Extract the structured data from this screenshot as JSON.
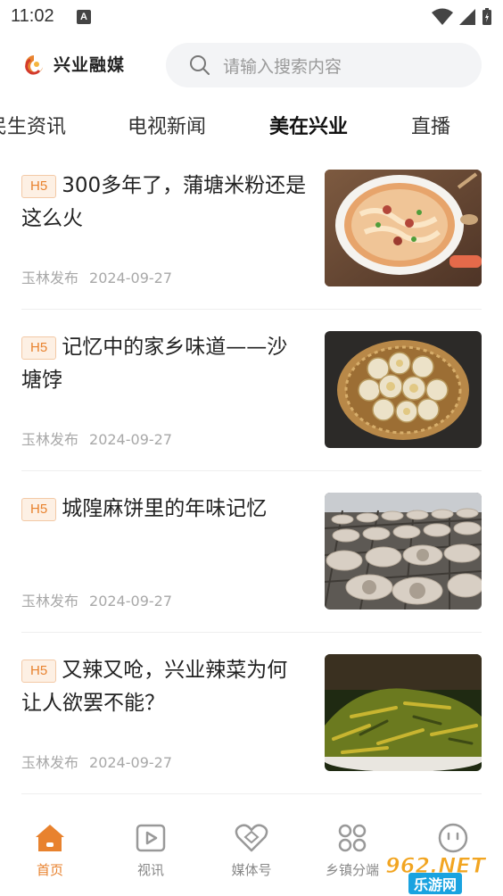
{
  "status_bar": {
    "time": "11:02",
    "app_indicator": "A"
  },
  "header": {
    "app_name": "兴业融媒",
    "search_placeholder": "请输入搜索内容"
  },
  "tabs": [
    {
      "label": "民生资讯",
      "active": false
    },
    {
      "label": "电视新闻",
      "active": false
    },
    {
      "label": "美在兴业",
      "active": true
    },
    {
      "label": "直播",
      "active": false
    }
  ],
  "articles": [
    {
      "badge": "H5",
      "title": "300多年了，蒲塘米粉还是这么火",
      "source": "玉林发布",
      "date": "2024-09-27",
      "image": "rice-noodle-bowl"
    },
    {
      "badge": "H5",
      "title": "记忆中的家乡味道——沙塘饽",
      "source": "玉林发布",
      "date": "2024-09-27",
      "image": "rice-cakes-basket"
    },
    {
      "badge": "H5",
      "title": "城隍麻饼里的年味记忆",
      "source": "玉林发布",
      "date": "2024-09-27",
      "image": "sesame-cakes-rack"
    },
    {
      "badge": "H5",
      "title": "又辣又呛，兴业辣菜为何让人欲罢不能？",
      "source": "玉林发布",
      "date": "2024-09-27",
      "image": "pickled-greens-plate"
    }
  ],
  "bottom_nav": [
    {
      "label": "首页",
      "icon": "home-icon",
      "active": true
    },
    {
      "label": "视讯",
      "icon": "video-icon",
      "active": false
    },
    {
      "label": "媒体号",
      "icon": "heart-icon",
      "active": false
    },
    {
      "label": "乡镇分端",
      "icon": "grid-icon",
      "active": false
    },
    {
      "label": "",
      "icon": "face-icon",
      "active": false
    }
  ],
  "watermark": {
    "text": "962.NET",
    "subtext": "乐游网"
  },
  "colors": {
    "accent": "#e8822e",
    "badge_bg": "#fdf0e4",
    "muted_text": "#a8a8a8"
  }
}
